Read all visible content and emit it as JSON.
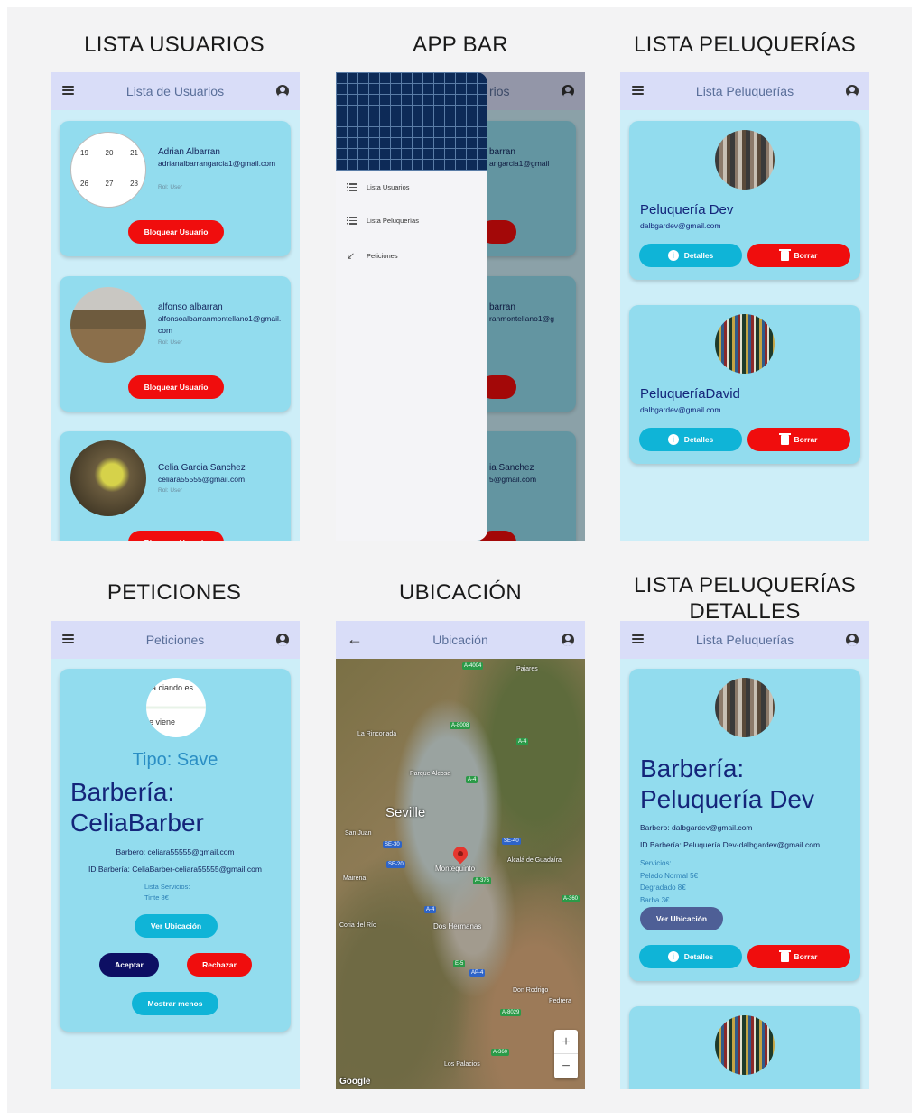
{
  "titles": {
    "lista_usuarios": "LISTA USUARIOS",
    "app_bar": "APP BAR",
    "lista_peluquerias": "LISTA PELUQUERÍAS",
    "peticiones": "PETICIONES",
    "ubicacion": "UBICACIÓN",
    "lista_peluquerias_detalles_1": "LISTA PELUQUERÍAS",
    "lista_peluquerias_detalles_2": "DETALLES"
  },
  "colors": {
    "appbar": "#d9ddf8",
    "screen_bg": "#cdeef8",
    "card": "#92dcee",
    "red_button": "#f00d0d",
    "cyan_button": "#0fb4d7",
    "navy_button": "#0d0f63",
    "text_dark": "#13225a"
  },
  "usuarios": {
    "appbar_title": "Lista de Usuarios",
    "block_label": "Bloquear Usuario",
    "calendar": [
      "19",
      "20",
      "21",
      "26",
      "27",
      "28"
    ],
    "users": [
      {
        "name": "Adrian Albarran",
        "email": "adrianalbarrangarcia1@gmail.com",
        "rol": "Rol: User"
      },
      {
        "name": "alfonso albarran",
        "email": "alfonsoalbarranmontellano1@gmail.com",
        "rol": "Rol: User"
      },
      {
        "name": "Celia Garcia Sanchez",
        "email": "celiara55555@gmail.com",
        "rol": "Rol: User"
      }
    ]
  },
  "appbar_screen": {
    "partial_title": "rios",
    "bg_names": [
      "barran",
      "barran",
      "ia Sanchez"
    ],
    "bg_emails": [
      "angarcia1@gmail",
      "ranmontellano1@g",
      "5@gmail.com"
    ],
    "drawer_items": [
      {
        "label": "Lista Usuarios",
        "icon": "list-icon"
      },
      {
        "label": "Lista Peluquerías",
        "icon": "list-icon"
      },
      {
        "label": "Peticiones",
        "icon": "arrow-down-left-icon"
      }
    ]
  },
  "peluquerias": {
    "appbar_title": "Lista Peluquerías",
    "details_label": "Detalles",
    "delete_label": "Borrar",
    "shops": [
      {
        "name": "Peluquería Dev",
        "email": "dalbgardev@gmail.com"
      },
      {
        "name": "PeluqueríaDavid",
        "email": "dalbgardev@gmail.com"
      }
    ]
  },
  "peticiones": {
    "appbar_title": "Peticiones",
    "avatar_text_1": "a ciando es",
    "avatar_text_2": "e viene",
    "tipo": "Tipo: Save",
    "barberia_line1": "Barbería:",
    "barberia_line2": "CeliaBarber",
    "barbero": "Barbero: celiara55555@gmail.com",
    "id_barberia": "ID Barbería: CeliaBarber-celiara55555@gmail.com",
    "servicios_label": "Lista Servicios:",
    "servicio_1": "Tinte 8€",
    "ver_ubicacion": "Ver Ubicación",
    "aceptar": "Aceptar",
    "rechazar": "Rechazar",
    "mostrar_menos": "Mostrar menos"
  },
  "ubicacion": {
    "appbar_title": "Ubicación",
    "city": "Seville",
    "labels": [
      "Montequinto",
      "Dos Hermanas",
      "La Rinconada",
      "Alcalá de Guadaíra",
      "San Juan",
      "Mairena",
      "Coria del Río",
      "Los Palacios",
      "Don Rodrigo",
      "Pedrera",
      "Parque Alcosa",
      "Pajares"
    ],
    "roads": [
      "A-4004",
      "A-8008",
      "A-4",
      "SE-30",
      "SE-40",
      "A-376",
      "SE-20",
      "A-4",
      "A-360",
      "A-4",
      "AP-4",
      "E-5",
      "A-360",
      "A-8029"
    ],
    "zoom_in": "+",
    "zoom_out": "−",
    "attribution": "Google"
  },
  "detalles": {
    "appbar_title": "Lista Peluquerías",
    "barberia_line1": "Barbería:",
    "barberia_line2": "Peluquería Dev",
    "barbero": "Barbero: dalbgardev@gmail.com",
    "id_barberia": "ID Barbería: Peluquería Dev-dalbgardev@gmail.com",
    "servicios_label": "Servicios:",
    "servicios": [
      "Pelado Normal 5€",
      "Degradado 8€",
      "Barba 3€"
    ],
    "ver_ubicacion": "Ver Ubicación",
    "details_label": "Detalles",
    "delete_label": "Borrar"
  }
}
